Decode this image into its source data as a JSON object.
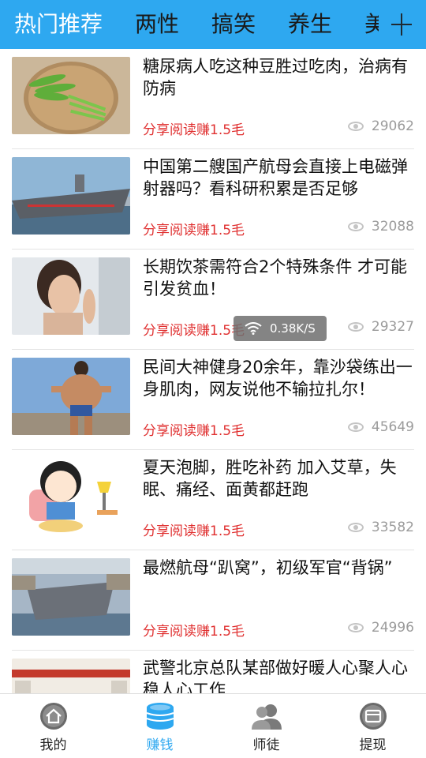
{
  "top_tabs": [
    "热门推荐",
    "两性",
    "搞笑",
    "养生",
    "美"
  ],
  "active_tab": 0,
  "colors": {
    "accent": "#2ea8f0",
    "earn_red": "#e03030",
    "views_gray": "#9b9b9b"
  },
  "feed": [
    {
      "title": "糖尿病人吃这种豆胜过吃肉，治病有防病",
      "earn": "分享阅读赚1.5毛",
      "views": "29062"
    },
    {
      "title": "中国第二艘国产航母会直接上电磁弹射器吗？看科研积累是否足够",
      "earn": "分享阅读赚1.5毛",
      "views": "32088"
    },
    {
      "title": "长期饮茶需符合2个特殊条件 才可能引发贫血！",
      "earn": "分享阅读赚1.5毛",
      "views": "29327"
    },
    {
      "title": "民间大神健身20余年，靠沙袋练出一身肌肉，网友说他不输拉扎尔！",
      "earn": "分享阅读赚1.5毛",
      "views": "45649"
    },
    {
      "title": "夏天泡脚，胜吃补药 加入艾草，失眠、痛经、面黄都赶跑",
      "earn": "分享阅读赚1.5毛",
      "views": "33582"
    },
    {
      "title": "最燃航母“趴窝”，初级军官“背锅”",
      "earn": "分享阅读赚1.5毛",
      "views": "24996"
    },
    {
      "title": "武警北京总队某部做好暖人心聚人心稳人心工作",
      "earn": "",
      "views": ""
    }
  ],
  "toast": {
    "speed": "0.38K/S"
  },
  "bottom_nav": [
    {
      "label": "我的",
      "icon": "home-icon"
    },
    {
      "label": "赚钱",
      "icon": "coins-icon"
    },
    {
      "label": "师徒",
      "icon": "people-icon"
    },
    {
      "label": "提现",
      "icon": "wallet-icon"
    }
  ],
  "active_nav": 1
}
